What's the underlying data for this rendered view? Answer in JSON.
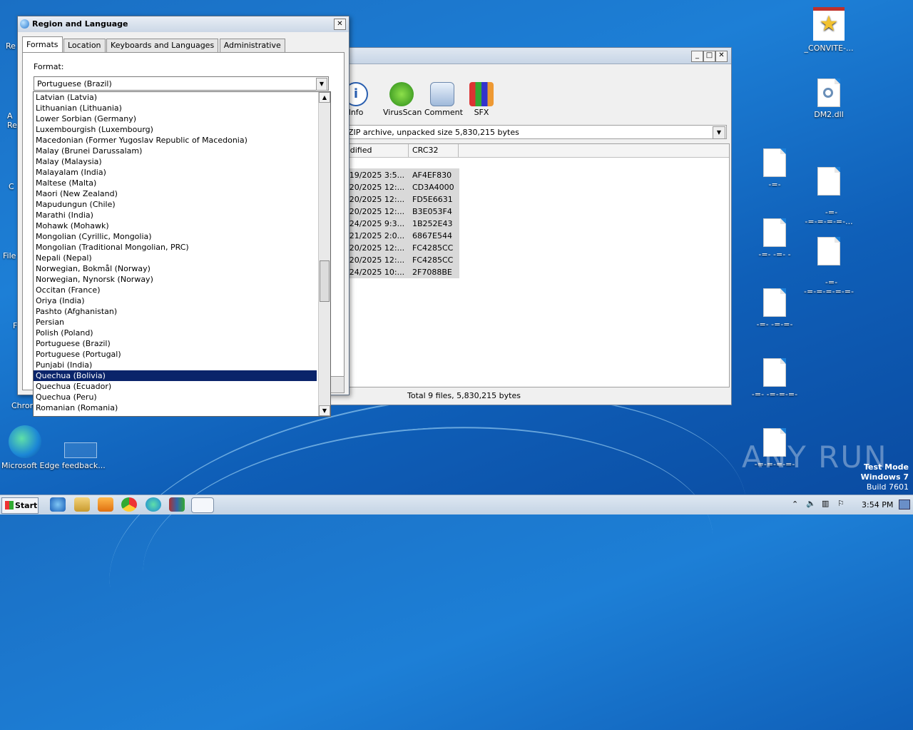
{
  "desktop": {
    "right_icons": [
      {
        "label": "_CONVITE-..."
      },
      {
        "label": "DM2.dll"
      },
      {
        "label": "-=-"
      },
      {
        "label": "-=-\n-=-=-=-=-..."
      },
      {
        "label": "-=- -=- -"
      },
      {
        "label": "-=-\n-=-=-=-=-=-"
      },
      {
        "label": "-=- -=-=-"
      },
      {
        "label": "-=- -=-=-=-"
      },
      {
        "label": "-=-=-=-=-"
      }
    ],
    "left_stubs": [
      "Re",
      "A\nRe",
      "C",
      "File",
      "F",
      "Chron"
    ],
    "edge_label": "Microsoft Edge feedback..."
  },
  "winrar": {
    "toolbar": [
      "Info",
      "VirusScan",
      "Comment",
      "SFX"
    ],
    "path_text": "ZIP archive, unpacked size 5,830,215 bytes",
    "columns": [
      "odified",
      "CRC32"
    ],
    "rows": [
      {
        "modified": "/19/2025 3:5...",
        "crc": "AF4EF830"
      },
      {
        "modified": "/20/2025 12:...",
        "crc": "CD3A4000"
      },
      {
        "modified": "/20/2025 12:...",
        "crc": "FD5E6631"
      },
      {
        "modified": "/20/2025 12:...",
        "crc": "B3E053F4"
      },
      {
        "modified": "/24/2025 9:3...",
        "crc": "1B252E43"
      },
      {
        "modified": "/21/2025 2:0...",
        "crc": "6867E544"
      },
      {
        "modified": "/20/2025 12:...",
        "crc": "FC4285CC"
      },
      {
        "modified": "/20/2025 12:...",
        "crc": "FC4285CC"
      },
      {
        "modified": "/24/2025 10:...",
        "crc": "2F7088BE"
      }
    ],
    "status": "Total 9 files, 5,830,215 bytes"
  },
  "dialog": {
    "title": "Region and Language",
    "tabs": [
      "Formats",
      "Location",
      "Keyboards and Languages",
      "Administrative"
    ],
    "format_label": "Format:",
    "format_value": "Portuguese (Brazil)",
    "options": [
      "Latvian (Latvia)",
      "Lithuanian (Lithuania)",
      "Lower Sorbian (Germany)",
      "Luxembourgish (Luxembourg)",
      "Macedonian (Former Yugoslav Republic of Macedonia)",
      "Malay (Brunei Darussalam)",
      "Malay (Malaysia)",
      "Malayalam (India)",
      "Maltese (Malta)",
      "Maori (New Zealand)",
      "Mapudungun (Chile)",
      "Marathi (India)",
      "Mohawk (Mohawk)",
      "Mongolian (Cyrillic, Mongolia)",
      "Mongolian (Traditional Mongolian, PRC)",
      "Nepali (Nepal)",
      "Norwegian, Bokmål (Norway)",
      "Norwegian, Nynorsk (Norway)",
      "Occitan (France)",
      "Oriya (India)",
      "Pashto (Afghanistan)",
      "Persian",
      "Polish (Poland)",
      "Portuguese (Brazil)",
      "Portuguese (Portugal)",
      "Punjabi (India)",
      "Quechua (Bolivia)",
      "Quechua (Ecuador)",
      "Quechua (Peru)",
      "Romanian (Romania)"
    ],
    "selected": "Quechua (Bolivia)"
  },
  "taskbar": {
    "start": "Start",
    "time": "3:54 PM"
  },
  "watermark": {
    "line1": "Test Mode",
    "line2": "Windows 7",
    "line3": "Build 7601",
    "brand": "ANY RUN"
  }
}
